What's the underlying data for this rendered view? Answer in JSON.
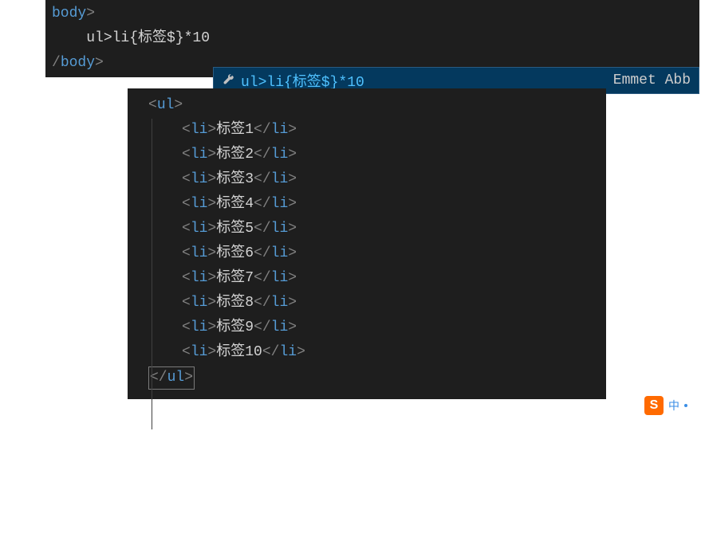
{
  "top_editor": {
    "line1_tag": "body",
    "line2_text": "ul>li{标签$}*10",
    "line3_tag": "body"
  },
  "autocomplete": {
    "suggestion": "ul>li{标签$}*10",
    "label": "Emmet Abb"
  },
  "bottom_editor": {
    "ul_open": "ul",
    "ul_close": "ul",
    "li_tag": "li",
    "items": [
      "标签1",
      "标签2",
      "标签3",
      "标签4",
      "标签5",
      "标签6",
      "标签7",
      "标签8",
      "标签9",
      "标签10"
    ]
  },
  "ime": {
    "icon_letter": "S",
    "text": "中"
  }
}
